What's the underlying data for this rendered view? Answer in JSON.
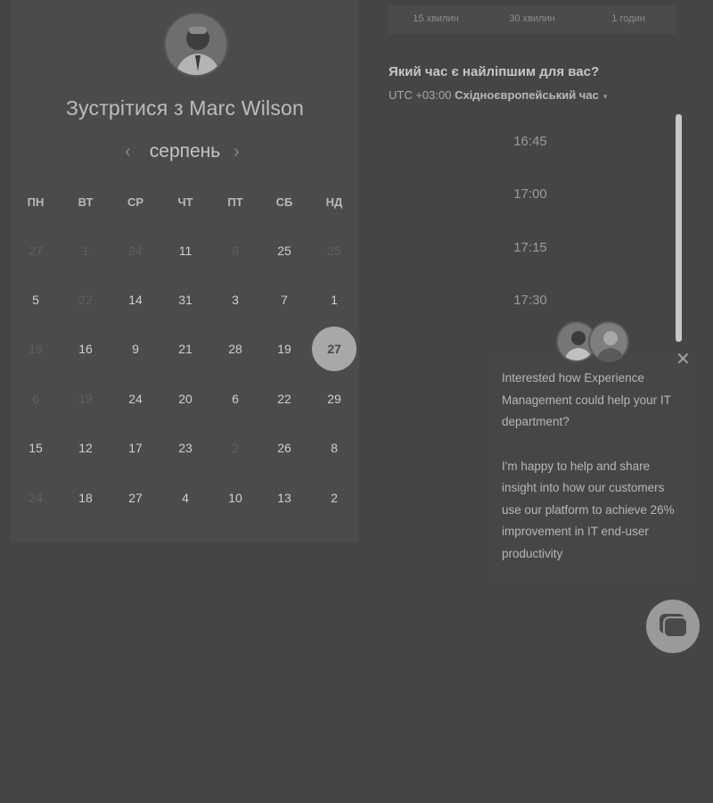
{
  "meeting": {
    "title": "Зустрітися з Marc Wilson",
    "month": "серпень",
    "prev_icon": "‹",
    "next_icon": "›"
  },
  "weekdays": [
    "ПН",
    "ВТ",
    "СР",
    "ЧТ",
    "ПТ",
    "СБ",
    "НД"
  ],
  "calendar_rows": [
    [
      {
        "d": "27",
        "dim": true
      },
      {
        "d": "1",
        "dim": true
      },
      {
        "d": "24",
        "dim": true
      },
      {
        "d": "11",
        "dim": false
      },
      {
        "d": "8",
        "dim": true
      },
      {
        "d": "25",
        "dim": false
      },
      {
        "d": "25",
        "dim": true
      }
    ],
    [
      {
        "d": "5",
        "dim": false
      },
      {
        "d": "22",
        "dim": true
      },
      {
        "d": "14",
        "dim": false
      },
      {
        "d": "31",
        "dim": false
      },
      {
        "d": "3",
        "dim": false
      },
      {
        "d": "7",
        "dim": false
      },
      {
        "d": "1",
        "dim": false
      }
    ],
    [
      {
        "d": "19",
        "dim": true
      },
      {
        "d": "16",
        "dim": false
      },
      {
        "d": "9",
        "dim": false
      },
      {
        "d": "21",
        "dim": false
      },
      {
        "d": "28",
        "dim": false
      },
      {
        "d": "19",
        "dim": false
      },
      {
        "d": "27",
        "dim": false,
        "selected": true
      }
    ],
    [
      {
        "d": "6",
        "dim": true
      },
      {
        "d": "19",
        "dim": true
      },
      {
        "d": "24",
        "dim": false
      },
      {
        "d": "20",
        "dim": false
      },
      {
        "d": "6",
        "dim": false
      },
      {
        "d": "22",
        "dim": false
      },
      {
        "d": "29",
        "dim": false
      }
    ],
    [
      {
        "d": "15",
        "dim": false
      },
      {
        "d": "12",
        "dim": false
      },
      {
        "d": "17",
        "dim": false
      },
      {
        "d": "23",
        "dim": false
      },
      {
        "d": "2",
        "dim": true
      },
      {
        "d": "26",
        "dim": false
      },
      {
        "d": "8",
        "dim": false
      }
    ],
    [
      {
        "d": "24",
        "dim": true
      },
      {
        "d": "18",
        "dim": false
      },
      {
        "d": "27",
        "dim": false
      },
      {
        "d": "4",
        "dim": false
      },
      {
        "d": "10",
        "dim": false
      },
      {
        "d": "13",
        "dim": false
      },
      {
        "d": "2",
        "dim": false
      }
    ]
  ],
  "durations": [
    "15 хвилин",
    "30 хвилин",
    "1 годин"
  ],
  "time_question": "Який час є найліпшим для вас?",
  "timezone": {
    "offset": "UTC +03:00",
    "name": "Східноєвропейський час",
    "caret_icon": "▾"
  },
  "time_slots": [
    "16:45",
    "17:00",
    "17:15",
    "17:30"
  ],
  "chat": {
    "close_icon": "✕",
    "lines": [
      "Interested how Experience",
      "Management could help your IT",
      "department?",
      "",
      "I'm happy to help and share",
      "insight into how our customers",
      "use our platform to achieve 26%",
      "improvement in IT end-user",
      "productivity"
    ]
  }
}
